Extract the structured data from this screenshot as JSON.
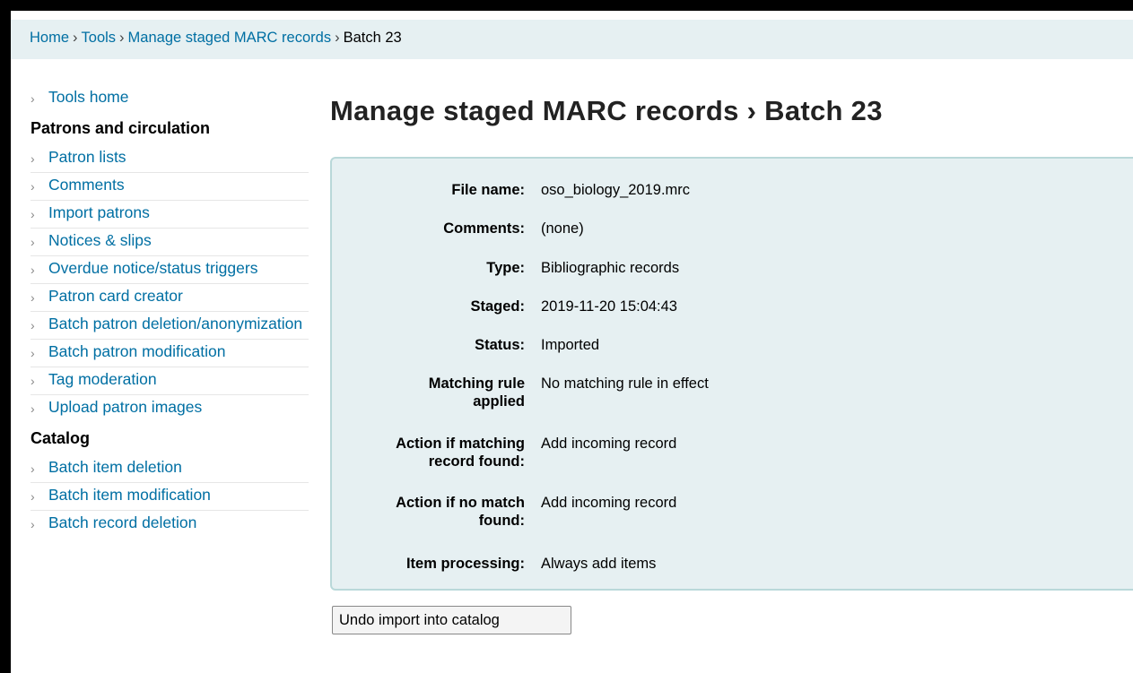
{
  "breadcrumbs": {
    "home": "Home",
    "tools": "Tools",
    "manage": "Manage staged MARC records",
    "current": "Batch 23",
    "separator": "›"
  },
  "sidebar": {
    "tools_home": "Tools home",
    "patrons_heading": "Patrons and circulation",
    "patrons_items": [
      "Patron lists",
      "Comments",
      "Import patrons",
      "Notices & slips",
      "Overdue notice/status triggers",
      "Patron card creator",
      "Batch patron deletion/anonymization",
      "Batch patron modification",
      "Tag moderation",
      "Upload patron images"
    ],
    "catalog_heading": "Catalog",
    "catalog_items": [
      "Batch item deletion",
      "Batch item modification",
      "Batch record deletion"
    ],
    "chevron": "›"
  },
  "page_title": "Manage staged MARC records › Batch 23",
  "details": {
    "file_name_label": "File name:",
    "file_name": "oso_biology_2019.mrc",
    "comments_label": "Comments:",
    "comments": "(none)",
    "type_label": "Type:",
    "type": "Bibliographic records",
    "staged_label": "Staged:",
    "staged": "2019-11-20 15:04:43",
    "status_label": "Status:",
    "status": "Imported",
    "matching_rule_label_1": "Matching rule",
    "matching_rule_label_2": "applied",
    "matching_rule": "No matching rule in effect",
    "action_match_label_1": "Action if matching",
    "action_match_label_2": "record found:",
    "action_match": "Add incoming record",
    "action_nomatch_label_1": "Action if no match",
    "action_nomatch_label_2": "found:",
    "action_nomatch": "Add incoming record",
    "item_processing_label": "Item processing:",
    "item_processing": "Always add items"
  },
  "undo_button": "Undo import into catalog",
  "colors": {
    "link": "#006fa3",
    "panel_bg": "#e6f0f2",
    "panel_border": "#b9d8d9"
  }
}
